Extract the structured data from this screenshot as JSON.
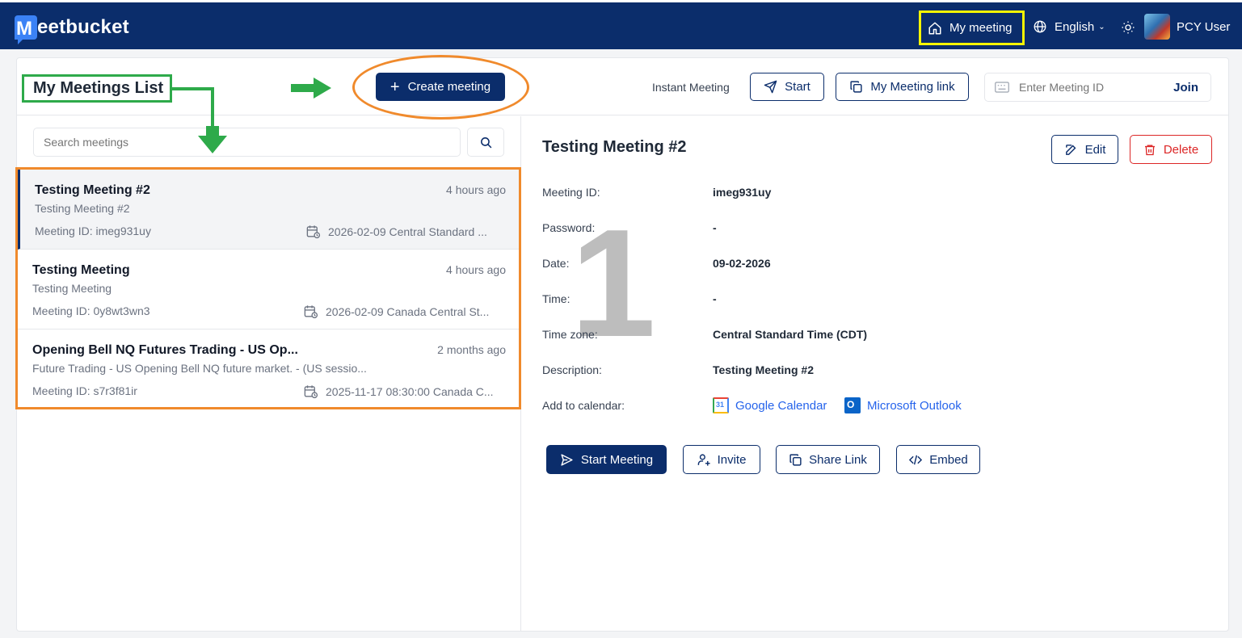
{
  "app": {
    "name": "Meetbucket",
    "logo_letter": "M",
    "logo_rest": "eetbucket"
  },
  "nav": {
    "my_meeting": "My meeting",
    "language": "English",
    "user": "PCY User"
  },
  "toolbar": {
    "list_title": "My Meetings List",
    "create_meeting": "Create meeting",
    "instant_meeting": "Instant Meeting",
    "start": "Start",
    "my_meeting_link": "My Meeting link",
    "meeting_id_placeholder": "Enter Meeting ID",
    "join": "Join"
  },
  "search": {
    "placeholder": "Search meetings"
  },
  "meetings": [
    {
      "title": "Testing Meeting #2",
      "ago": "4 hours ago",
      "subtitle": "Testing Meeting #2",
      "meeting_id": "Meeting ID: imeg931uy",
      "datetime": "2026-02-09 Central Standard ..."
    },
    {
      "title": "Testing Meeting",
      "ago": "4 hours ago",
      "subtitle": "Testing Meeting",
      "meeting_id": "Meeting ID: 0y8wt3wn3",
      "datetime": "2026-02-09 Canada Central St..."
    },
    {
      "title": "Opening Bell NQ Futures Trading - US Op...",
      "ago": "2 months ago",
      "subtitle": "Future Trading - US Opening Bell NQ future market. - (US sessio...",
      "meeting_id": "Meeting ID: s7r3f81ir",
      "datetime": "2025-11-17 08:30:00 Canada C..."
    }
  ],
  "detail": {
    "title": "Testing Meeting #2",
    "edit": "Edit",
    "delete": "Delete",
    "annotation_number": "1",
    "fields": [
      {
        "label": "Meeting ID:",
        "value": "imeg931uy"
      },
      {
        "label": "Password:",
        "value": "-"
      },
      {
        "label": "Date:",
        "value": "09-02-2026"
      },
      {
        "label": "Time:",
        "value": "-"
      },
      {
        "label": "Time zone:",
        "value": "Central Standard Time (CDT)"
      },
      {
        "label": "Description:",
        "value": "Testing Meeting #2"
      }
    ],
    "calendar_label": "Add to calendar:",
    "google_calendar": "Google Calendar",
    "google_icon_text": "31",
    "microsoft_outlook": "Microsoft Outlook",
    "outlook_icon_text": "O",
    "actions": {
      "start_meeting": "Start Meeting",
      "invite": "Invite",
      "share_link": "Share Link",
      "embed": "Embed"
    }
  },
  "colors": {
    "brand_navy": "#0b2d6b",
    "annotation_green": "#2eaa4a",
    "annotation_orange": "#f08a2c",
    "annotation_yellow": "#f5f500",
    "danger": "#dc2626",
    "link_blue": "#2563eb"
  }
}
